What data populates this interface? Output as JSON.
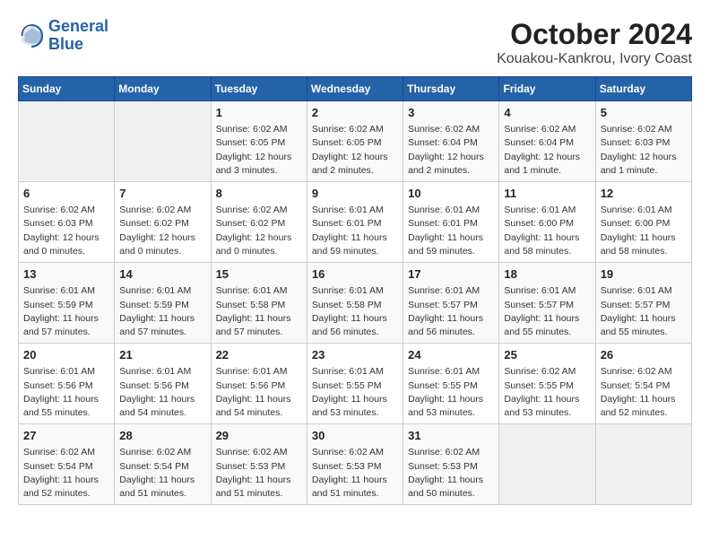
{
  "header": {
    "logo_line1": "General",
    "logo_line2": "Blue",
    "month": "October 2024",
    "location": "Kouakou-Kankrou, Ivory Coast"
  },
  "weekdays": [
    "Sunday",
    "Monday",
    "Tuesday",
    "Wednesday",
    "Thursday",
    "Friday",
    "Saturday"
  ],
  "weeks": [
    [
      {
        "day": "",
        "info": ""
      },
      {
        "day": "",
        "info": ""
      },
      {
        "day": "1",
        "info": "Sunrise: 6:02 AM\nSunset: 6:05 PM\nDaylight: 12 hours\nand 3 minutes."
      },
      {
        "day": "2",
        "info": "Sunrise: 6:02 AM\nSunset: 6:05 PM\nDaylight: 12 hours\nand 2 minutes."
      },
      {
        "day": "3",
        "info": "Sunrise: 6:02 AM\nSunset: 6:04 PM\nDaylight: 12 hours\nand 2 minutes."
      },
      {
        "day": "4",
        "info": "Sunrise: 6:02 AM\nSunset: 6:04 PM\nDaylight: 12 hours\nand 1 minute."
      },
      {
        "day": "5",
        "info": "Sunrise: 6:02 AM\nSunset: 6:03 PM\nDaylight: 12 hours\nand 1 minute."
      }
    ],
    [
      {
        "day": "6",
        "info": "Sunrise: 6:02 AM\nSunset: 6:03 PM\nDaylight: 12 hours\nand 0 minutes."
      },
      {
        "day": "7",
        "info": "Sunrise: 6:02 AM\nSunset: 6:02 PM\nDaylight: 12 hours\nand 0 minutes."
      },
      {
        "day": "8",
        "info": "Sunrise: 6:02 AM\nSunset: 6:02 PM\nDaylight: 12 hours\nand 0 minutes."
      },
      {
        "day": "9",
        "info": "Sunrise: 6:01 AM\nSunset: 6:01 PM\nDaylight: 11 hours\nand 59 minutes."
      },
      {
        "day": "10",
        "info": "Sunrise: 6:01 AM\nSunset: 6:01 PM\nDaylight: 11 hours\nand 59 minutes."
      },
      {
        "day": "11",
        "info": "Sunrise: 6:01 AM\nSunset: 6:00 PM\nDaylight: 11 hours\nand 58 minutes."
      },
      {
        "day": "12",
        "info": "Sunrise: 6:01 AM\nSunset: 6:00 PM\nDaylight: 11 hours\nand 58 minutes."
      }
    ],
    [
      {
        "day": "13",
        "info": "Sunrise: 6:01 AM\nSunset: 5:59 PM\nDaylight: 11 hours\nand 57 minutes."
      },
      {
        "day": "14",
        "info": "Sunrise: 6:01 AM\nSunset: 5:59 PM\nDaylight: 11 hours\nand 57 minutes."
      },
      {
        "day": "15",
        "info": "Sunrise: 6:01 AM\nSunset: 5:58 PM\nDaylight: 11 hours\nand 57 minutes."
      },
      {
        "day": "16",
        "info": "Sunrise: 6:01 AM\nSunset: 5:58 PM\nDaylight: 11 hours\nand 56 minutes."
      },
      {
        "day": "17",
        "info": "Sunrise: 6:01 AM\nSunset: 5:57 PM\nDaylight: 11 hours\nand 56 minutes."
      },
      {
        "day": "18",
        "info": "Sunrise: 6:01 AM\nSunset: 5:57 PM\nDaylight: 11 hours\nand 55 minutes."
      },
      {
        "day": "19",
        "info": "Sunrise: 6:01 AM\nSunset: 5:57 PM\nDaylight: 11 hours\nand 55 minutes."
      }
    ],
    [
      {
        "day": "20",
        "info": "Sunrise: 6:01 AM\nSunset: 5:56 PM\nDaylight: 11 hours\nand 55 minutes."
      },
      {
        "day": "21",
        "info": "Sunrise: 6:01 AM\nSunset: 5:56 PM\nDaylight: 11 hours\nand 54 minutes."
      },
      {
        "day": "22",
        "info": "Sunrise: 6:01 AM\nSunset: 5:56 PM\nDaylight: 11 hours\nand 54 minutes."
      },
      {
        "day": "23",
        "info": "Sunrise: 6:01 AM\nSunset: 5:55 PM\nDaylight: 11 hours\nand 53 minutes."
      },
      {
        "day": "24",
        "info": "Sunrise: 6:01 AM\nSunset: 5:55 PM\nDaylight: 11 hours\nand 53 minutes."
      },
      {
        "day": "25",
        "info": "Sunrise: 6:02 AM\nSunset: 5:55 PM\nDaylight: 11 hours\nand 53 minutes."
      },
      {
        "day": "26",
        "info": "Sunrise: 6:02 AM\nSunset: 5:54 PM\nDaylight: 11 hours\nand 52 minutes."
      }
    ],
    [
      {
        "day": "27",
        "info": "Sunrise: 6:02 AM\nSunset: 5:54 PM\nDaylight: 11 hours\nand 52 minutes."
      },
      {
        "day": "28",
        "info": "Sunrise: 6:02 AM\nSunset: 5:54 PM\nDaylight: 11 hours\nand 51 minutes."
      },
      {
        "day": "29",
        "info": "Sunrise: 6:02 AM\nSunset: 5:53 PM\nDaylight: 11 hours\nand 51 minutes."
      },
      {
        "day": "30",
        "info": "Sunrise: 6:02 AM\nSunset: 5:53 PM\nDaylight: 11 hours\nand 51 minutes."
      },
      {
        "day": "31",
        "info": "Sunrise: 6:02 AM\nSunset: 5:53 PM\nDaylight: 11 hours\nand 50 minutes."
      },
      {
        "day": "",
        "info": ""
      },
      {
        "day": "",
        "info": ""
      }
    ]
  ]
}
